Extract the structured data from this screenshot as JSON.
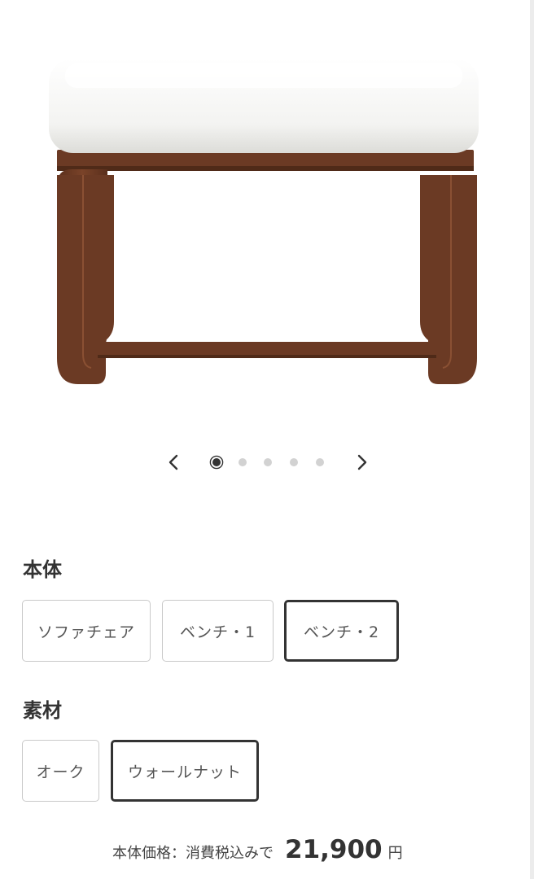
{
  "product": {
    "image": "walnut-bench-white-cushion"
  },
  "carousel": {
    "prev_icon": "chevron-left-icon",
    "next_icon": "chevron-right-icon",
    "current_slide": 1,
    "total_slides": 5
  },
  "body_section": {
    "title": "本体",
    "options": [
      "ソファチェア",
      "ベンチ・1",
      "ベンチ・2"
    ],
    "selected": "ベンチ・2"
  },
  "material_section": {
    "title": "素材",
    "options": [
      "オーク",
      "ウォールナット"
    ],
    "selected": "ウォールナット"
  },
  "price": {
    "label": "本体価格：消費税込みで",
    "value": "21,900",
    "unit": "円"
  },
  "colors": {
    "text": "#333333",
    "option_border": "#c9c9c9",
    "selected_border": "#333333",
    "dot_inactive": "#d2d2d2",
    "wood": "#6b3a24",
    "cushion": "#f5f5f3"
  }
}
